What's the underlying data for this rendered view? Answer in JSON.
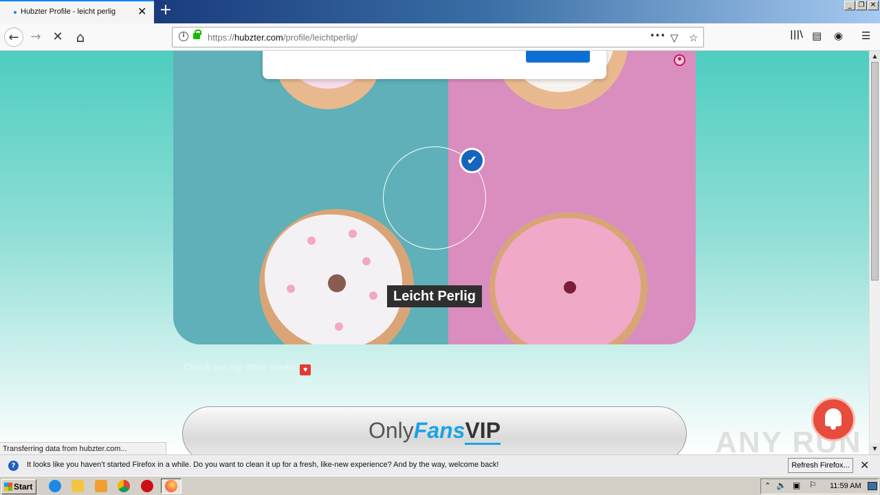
{
  "browser": {
    "tab_title": "Hubzter Profile - leicht perlig",
    "tab_close": "✕",
    "new_tab": "+",
    "window_buttons": [
      "_",
      "❐",
      "✕"
    ],
    "url_scheme": "https://",
    "url_host": "hubzter.com",
    "url_path": "/profile/leichtperlig/",
    "page_actions": "•••",
    "back": "←",
    "forward": "→",
    "stop": "✕",
    "home": "⌂",
    "library": "|||\\",
    "sidebar": "▤",
    "account": "◉",
    "menu": "☰",
    "pocket": "▽",
    "bookmark": "☆"
  },
  "profile": {
    "name": "Leicht Perlig",
    "verified_mark": "✔",
    "media_text": "Check out my other media",
    "heart": "♥",
    "onlyfans": {
      "only": "Only",
      "fans": "Fans",
      "vip": "VIP"
    }
  },
  "status_text": "Transferring data from hubzter.com...",
  "notification": {
    "icon": "?",
    "message": "It looks like you haven’t started Firefox in a while. Do you want to clean it up for a fresh, like-new experience? And by the way, welcome back!",
    "button": "Refresh Firefox...",
    "close": "✕"
  },
  "watermark": "ANY  RUN",
  "taskbar": {
    "start": "Start",
    "clock": "11:59 AM"
  },
  "colors": {
    "accent": "#0a84ff",
    "verified": "#1565c0",
    "bell": "#e74c3c"
  }
}
